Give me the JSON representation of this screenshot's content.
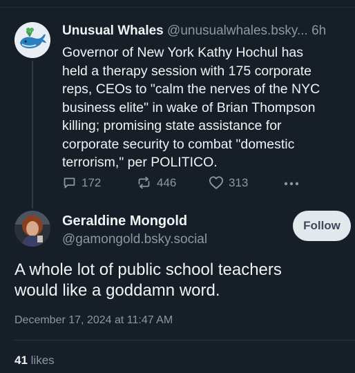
{
  "parent_post": {
    "display_name": "Unusual Whales",
    "handle": "@unusualwhales.bsky...",
    "time": "6h",
    "text": "Governor of New York Kathy Hochul has\nheld a therapy session with 175 corporate\nreps, CEOs to \"calm the nerves of the NYC\nbusiness elite\" in wake of Brian Thompson\nkilling; promising state assistance for\ncorporate security to combat \"domestic\nterrorism,\" per POLITICO.",
    "actions": {
      "replies": "172",
      "reposts": "446",
      "likes": "313"
    }
  },
  "main_post": {
    "display_name": "Geraldine Mongold",
    "handle": "@gamongold.bsky.social",
    "follow_label": "Follow",
    "text": "A whole lot of public school teachers\nwould like a goddamn word.",
    "date": "December 17, 2024 at 11:47 AM",
    "likes_count": "41",
    "likes_label": "likes"
  },
  "icons": {
    "reply": "reply-icon",
    "repost": "repost-icon",
    "like": "heart-icon",
    "more": "more-icon"
  },
  "colors": {
    "background": "#161e27",
    "text": "#f1f3f5",
    "muted": "#8b98a5",
    "follow_bg": "#e3e8ed"
  }
}
